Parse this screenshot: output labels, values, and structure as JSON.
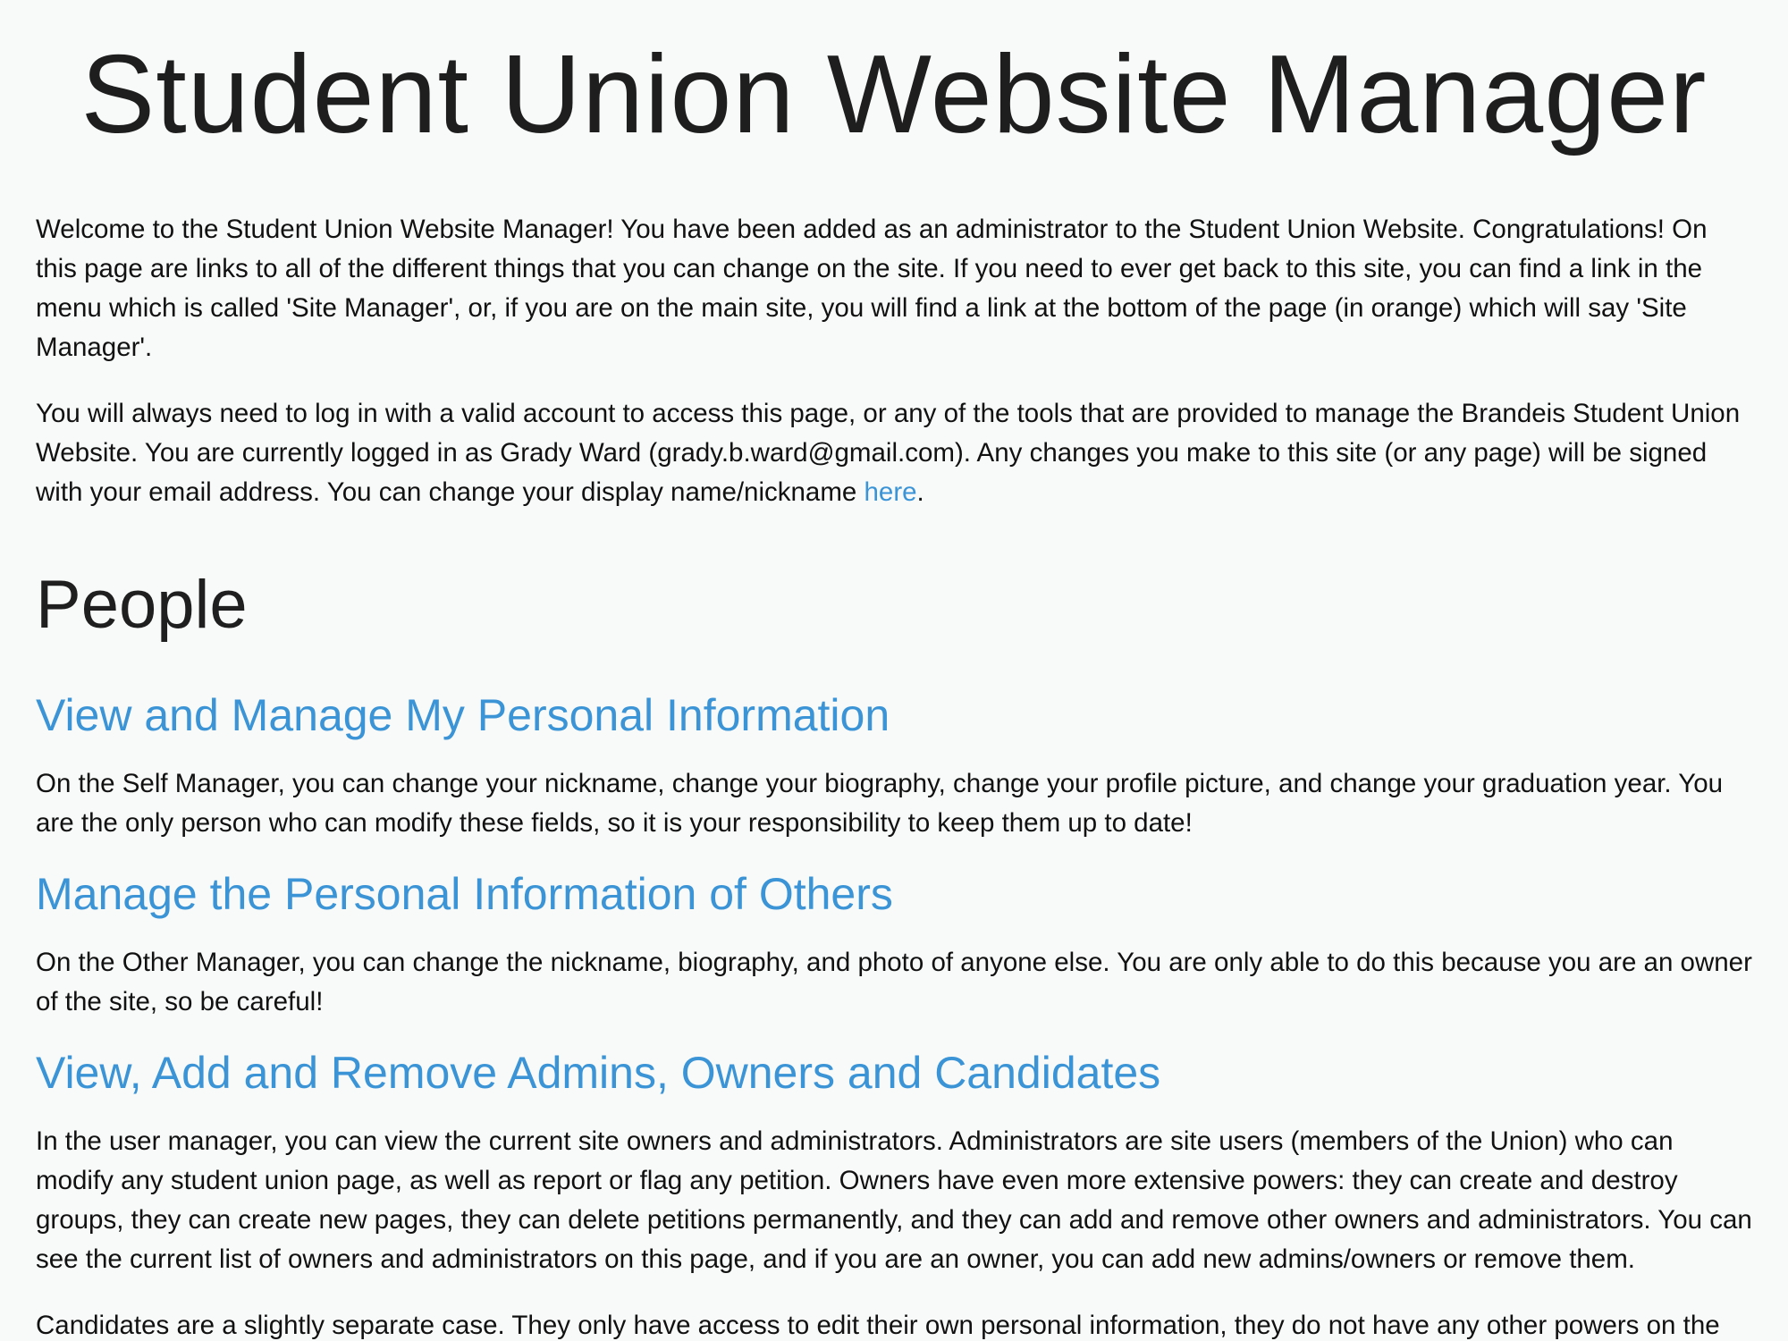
{
  "page": {
    "title": "Student Union Website Manager"
  },
  "intro": {
    "paragraph1": "Welcome to the Student Union Website Manager! You have been added as an administrator to the Student Union Website. Congratulations! On this page are links to all of the different things that you can change on the site. If you need to ever get back to this site, you can find a link in the menu which is called 'Site Manager', or, if you are on the main site, you will find a link at the bottom of the page (in orange) which will say 'Site Manager'.",
    "paragraph2_text": "You will always need to log in with a valid account to access this page, or any of the tools that are provided to manage the Brandeis Student Union Website. You are currently logged in as Grady Ward (grady.b.ward@gmail.com). Any changes you make to this site (or any page) will be signed with your email address. You can change your display name/nickname ",
    "paragraph2_link": "here",
    "paragraph2_end": "."
  },
  "sections": {
    "people": {
      "heading": "People",
      "items": [
        {
          "title": "View and Manage My Personal Information",
          "description": "On the Self Manager, you can change your nickname, change your biography, change your profile picture, and change your graduation year. You are the only person who can modify these fields, so it is your responsibility to keep them up to date!"
        },
        {
          "title": "Manage the Personal Information of Others",
          "description": "On the Other Manager, you can change the nickname, biography, and photo of anyone else. You are only able to do this because you are an owner of the site, so be careful!"
        },
        {
          "title": "View, Add and Remove Admins, Owners and Candidates",
          "description": "In the user manager, you can view the current site owners and administrators. Administrators are site users (members of the Union) who can modify any student union page, as well as report or flag any petition. Owners have even more extensive powers: they can create and destroy groups, they can create new pages, they can delete petitions permanently, and they can add and remove other owners and administrators. You can see the current list of owners and administrators on this page, and if you are an owner, you can add new admins/owners or remove them.",
          "description2": "Candidates are a slightly separate case. They only have access to edit their own personal information, they do not have any other powers on the"
        }
      ]
    }
  },
  "colors": {
    "background": "#f8f9f9",
    "link": "#3a94d6",
    "text": "#111111"
  }
}
